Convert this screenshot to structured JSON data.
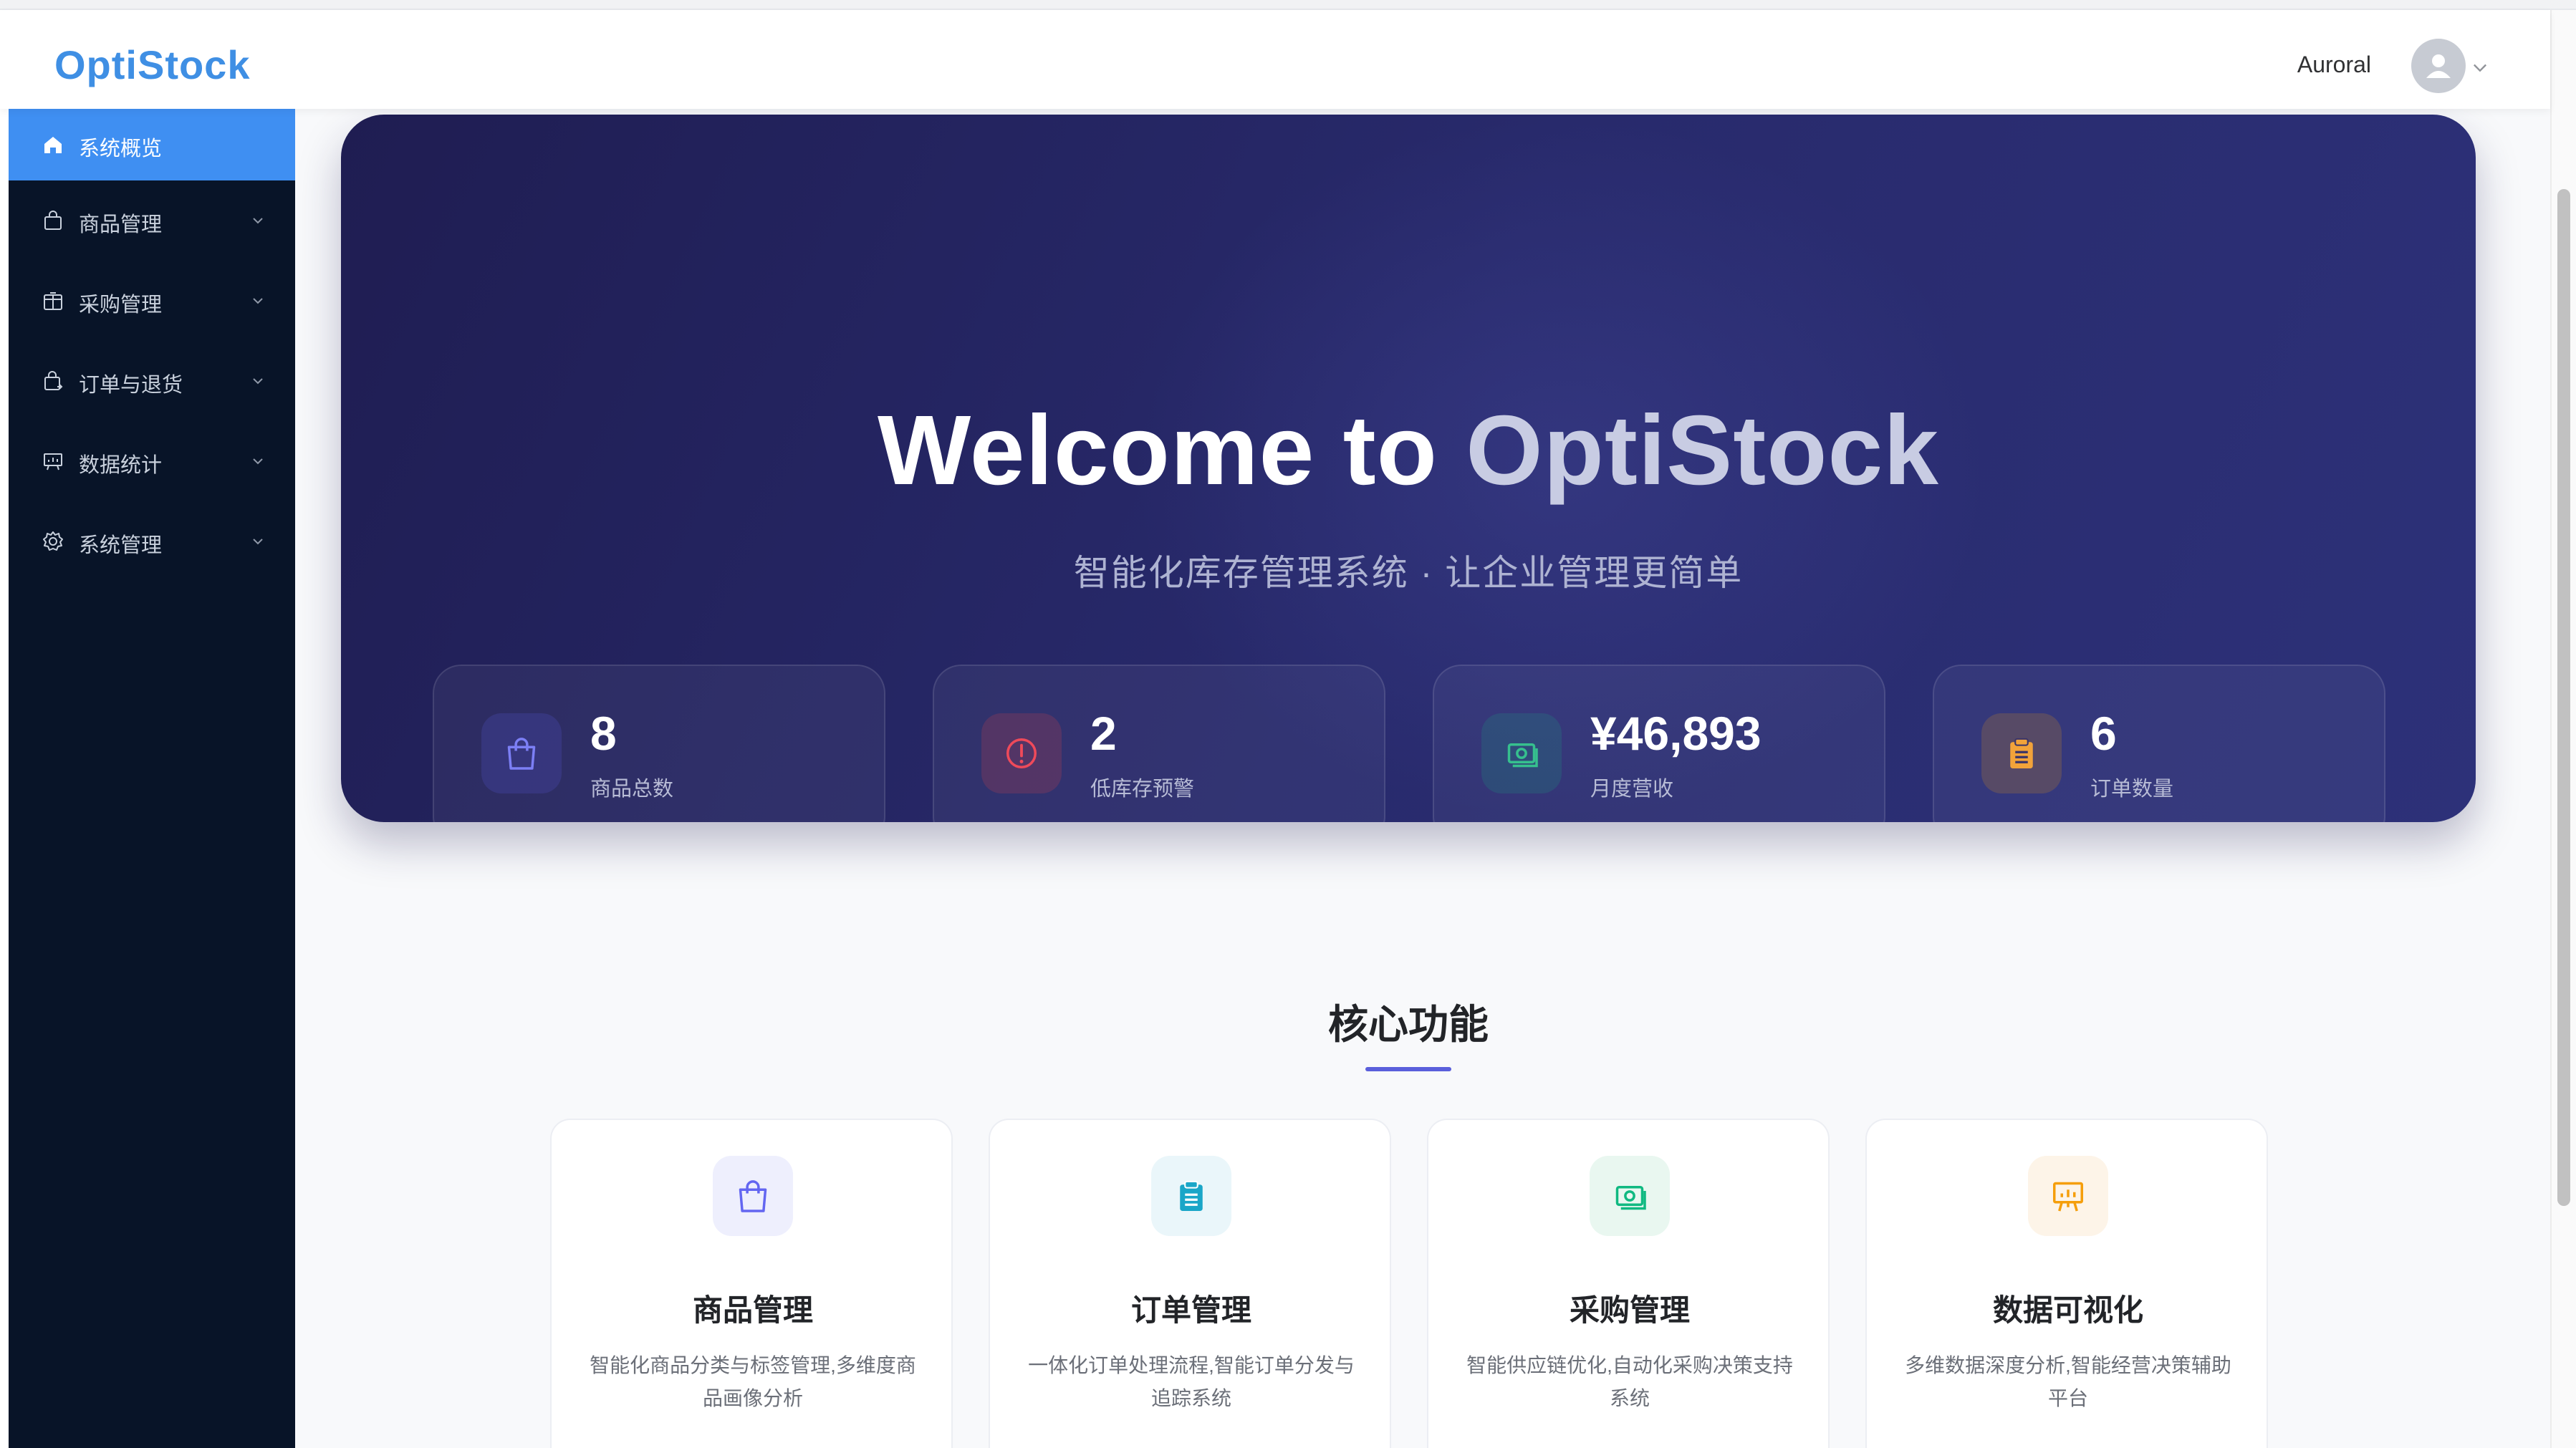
{
  "app": {
    "logo": "OptiStock",
    "user_name": "Auroral"
  },
  "colors": {
    "accent": "#3f8ff2",
    "sidebar_bg": "#081428",
    "hero_bg": "#282a6c"
  },
  "sidebar": {
    "items": [
      {
        "label": "系统概览",
        "icon": "home-icon",
        "active": true
      },
      {
        "label": "商品管理",
        "icon": "shopping-bag-icon"
      },
      {
        "label": "采购管理",
        "icon": "purchase-box-icon"
      },
      {
        "label": "订单与退货",
        "icon": "order-return-icon"
      },
      {
        "label": "数据统计",
        "icon": "data-chart-icon"
      },
      {
        "label": "系统管理",
        "icon": "gear-icon"
      }
    ]
  },
  "hero": {
    "title_part1": "Welcome to ",
    "title_part2": "OptiStock",
    "subtitle": "智能化库存管理系统 · 让企业管理更简单"
  },
  "stats": [
    {
      "value": "8",
      "label": "商品总数",
      "icon": "shopping-bag-icon",
      "color": "#6366f1"
    },
    {
      "value": "2",
      "label": "低库存预警",
      "icon": "warning-icon",
      "color": "#ef4444"
    },
    {
      "value": "¥46,893",
      "label": "月度营收",
      "icon": "money-icon",
      "color": "#10b981"
    },
    {
      "value": "6",
      "label": "订单数量",
      "icon": "clipboard-icon",
      "color": "#f59e0b"
    }
  ],
  "features": {
    "title": "核心功能",
    "cards": [
      {
        "name": "商品管理",
        "desc": "智能化商品分类与标签管理,多维度商品画像分析",
        "icon": "shopping-bag-icon",
        "color": "#6366f1"
      },
      {
        "name": "订单管理",
        "desc": "一体化订单处理流程,智能订单分发与追踪系统",
        "icon": "clipboard-icon",
        "color": "#0ea5c9"
      },
      {
        "name": "采购管理",
        "desc": "智能供应链优化,自动化采购决策支持系统",
        "icon": "money-icon",
        "color": "#10b981"
      },
      {
        "name": "数据可视化",
        "desc": "多维数据深度分析,智能经营决策辅助平台",
        "icon": "presentation-chart-icon",
        "color": "#f59e0b"
      }
    ]
  }
}
